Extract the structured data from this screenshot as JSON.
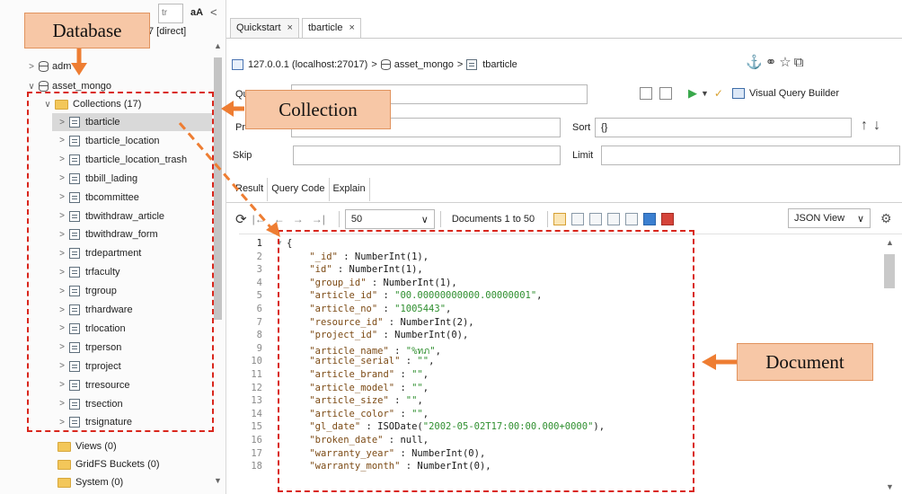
{
  "sidebar": {
    "filter_placeholder": "tr",
    "case_toggle": "aA",
    "collapse_glyph": "<",
    "connection_suffix": "7 [direct]",
    "databases": [
      {
        "name": "adm",
        "expanded": false
      },
      {
        "name": "asset_mongo",
        "expanded": true
      }
    ],
    "collections_folder": "Collections (17)",
    "collections": [
      "tbarticle",
      "tbarticle_location",
      "tbarticle_location_trash",
      "tbbill_lading",
      "tbcommittee",
      "tbwithdraw_article",
      "tbwithdraw_form",
      "trdepartment",
      "trfaculty",
      "trgroup",
      "trhardware",
      "trlocation",
      "trperson",
      "trproject",
      "trresource",
      "trsection",
      "trsignature"
    ],
    "selected_collection": "tbarticle",
    "folders": [
      "Views (0)",
      "GridFS Buckets (0)",
      "System (0)"
    ]
  },
  "tabs": [
    {
      "label": "Quickstart",
      "close": "×"
    },
    {
      "label": "tbarticle",
      "close": "×",
      "active": true
    }
  ],
  "path": {
    "server": "127.0.0.1 (localhost:27017)",
    "sep": ">",
    "database": "asset_mongo",
    "collection": "tbarticle"
  },
  "query_form": {
    "query_label": "Qu",
    "projection_label": "Pr",
    "sort_label": "Sort",
    "sort_value": "{}",
    "skip_label": "Skip",
    "limit_label": "Limit",
    "visual_query_builder": "Visual Query Builder"
  },
  "result_tabs": [
    "Result",
    "Query Code",
    "Explain"
  ],
  "navigation": {
    "page_size": "50",
    "documents_label": "Documents 1 to 50",
    "view_mode": "JSON View"
  },
  "editor": {
    "line_numbers": [
      "1",
      "2",
      "3",
      "4",
      "5",
      "6",
      "7",
      "8",
      "9",
      "10",
      "11",
      "12",
      "13",
      "14",
      "15",
      "16",
      "17",
      "18"
    ],
    "lines": [
      {
        "key": "",
        "value": "{"
      },
      {
        "key": "\"_id\"",
        "value": " : NumberInt(1),"
      },
      {
        "key": "\"id\"",
        "value": " : NumberInt(1),"
      },
      {
        "key": "\"group_id\"",
        "value": " : NumberInt(1),"
      },
      {
        "key": "\"article_id\"",
        "value": " : ",
        "str": "\"00.00000000000.00000001\"",
        "tail": ","
      },
      {
        "key": "\"article_no\"",
        "value": " : ",
        "str": "\"1005443\"",
        "tail": ","
      },
      {
        "key": "\"resource_id\"",
        "value": " : NumberInt(2),"
      },
      {
        "key": "\"project_id\"",
        "value": " : NumberInt(0),"
      },
      {
        "key": "\"article_name\"",
        "value": " : ",
        "str": "\"%ทภ\"",
        "tail": ","
      },
      {
        "key": "\"article_serial\"",
        "value": " : ",
        "str": "\"\"",
        "tail": ","
      },
      {
        "key": "\"article_brand\"",
        "value": " : ",
        "str": "\"\"",
        "tail": ","
      },
      {
        "key": "\"article_model\"",
        "value": " : ",
        "str": "\"\"",
        "tail": ","
      },
      {
        "key": "\"article_size\"",
        "value": " : ",
        "str": "\"\"",
        "tail": ","
      },
      {
        "key": "\"article_color\"",
        "value": " : ",
        "str": "\"\"",
        "tail": ","
      },
      {
        "key": "\"gl_date\"",
        "value": " : ISODate(",
        "str": "\"2002-05-02T17:00:00.000+0000\"",
        "tail": "),"
      },
      {
        "key": "\"broken_date\"",
        "value": " : null,"
      },
      {
        "key": "\"warranty_year\"",
        "value": " : NumberInt(0),"
      },
      {
        "key": "\"warranty_month\"",
        "value": " : NumberInt(0),"
      }
    ]
  },
  "annotations": {
    "database": "Database",
    "collection": "Collection",
    "document": "Document"
  },
  "colors": {
    "callout_fill": "#f7c7a6",
    "callout_border": "#e1935e",
    "arrow": "#ee7d32",
    "dashed_box": "#d9261c"
  }
}
